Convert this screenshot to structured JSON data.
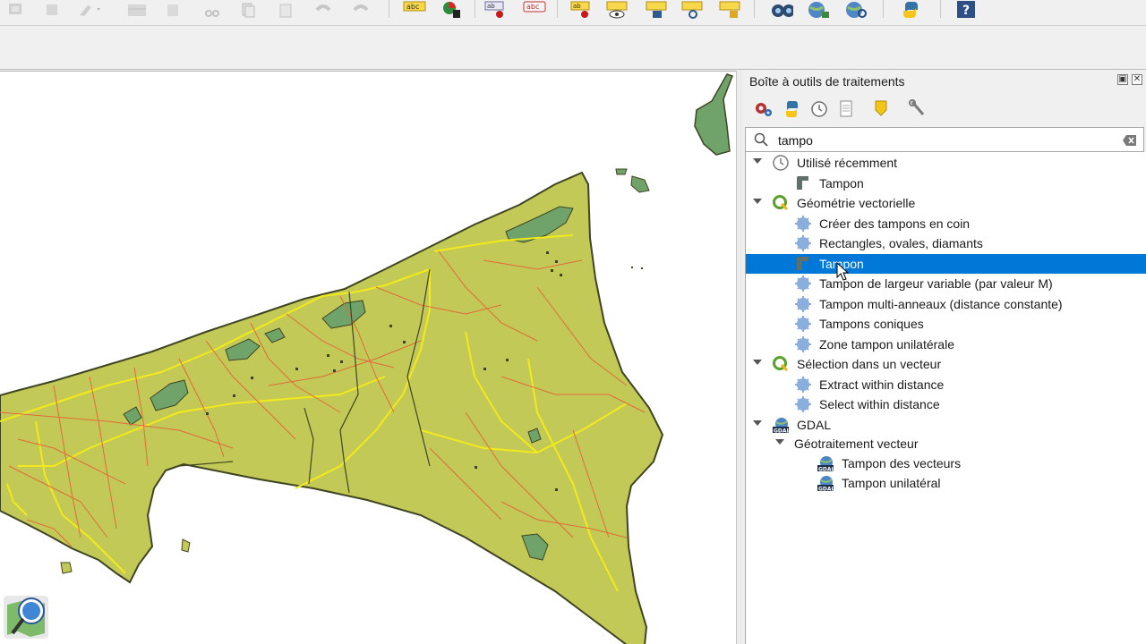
{
  "toolbar": {
    "icons": [
      "select-features-icon",
      "deselect-icon",
      "edit-digitize-icon",
      "attribute-table-icon",
      "delete-icon",
      "cut-icon",
      "copy-icon",
      "paste-icon",
      "undo-icon",
      "redo-icon",
      "label-abc-icon",
      "diagram-icon",
      "label-pin-icon",
      "label-remove-icon",
      "label-move-icon",
      "label-show-hide-icon",
      "label-edit-icon",
      "label-rotate-icon",
      "label-change-icon",
      "binoculars-icon",
      "globe-add-icon",
      "globe-search-icon",
      "python-icon",
      "help-icon"
    ]
  },
  "panel": {
    "title": "Boîte à outils de traitements",
    "tools": [
      "gear-process-icon",
      "python-icon",
      "clock-history-icon",
      "results-document-icon",
      "edit-pencil-icon",
      "wrench-options-icon"
    ],
    "search": {
      "value": "tampo"
    }
  },
  "tree": {
    "recent": {
      "label": "Utilisé récemment",
      "items": [
        {
          "label": "Tampon"
        }
      ]
    },
    "vector_geometry": {
      "label": "Géométrie vectorielle",
      "items": [
        {
          "label": "Créer des tampons en coin"
        },
        {
          "label": "Rectangles, ovales, diamants"
        },
        {
          "label": "Tampon"
        },
        {
          "label": "Tampon de largeur variable (par valeur M)"
        },
        {
          "label": "Tampon multi-anneaux (distance constante)"
        },
        {
          "label": "Tampons coniques"
        },
        {
          "label": "Zone tampon unilatérale"
        }
      ]
    },
    "vector_selection": {
      "label": "Sélection dans un vecteur",
      "items": [
        {
          "label": "Extract within distance"
        },
        {
          "label": "Select within distance"
        }
      ]
    },
    "gdal": {
      "label": "GDAL",
      "subgroup": {
        "label": "Géotraitement vecteur",
        "items": [
          {
            "label": "Tampon des vecteurs"
          },
          {
            "label": "Tampon unilatéral"
          }
        ]
      }
    }
  },
  "colors": {
    "land": "#c3c956",
    "coast": "#3f4423",
    "road_major": "#f2ea1c",
    "road_minor": "#e06b3a",
    "water": "#6fa36a",
    "selection": "#0078d7"
  }
}
